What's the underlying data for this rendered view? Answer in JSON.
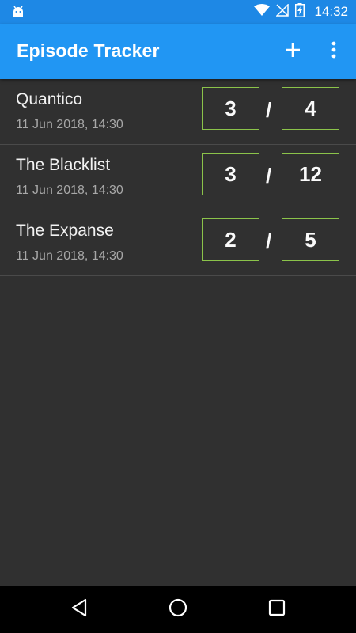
{
  "status_bar": {
    "time": "14:32",
    "icons": [
      "android-icon",
      "wifi-icon",
      "no-signal-icon",
      "battery-charging-icon"
    ]
  },
  "app_bar": {
    "title": "Episode Tracker",
    "actions": [
      "add-icon",
      "overflow-menu-icon"
    ]
  },
  "shows": [
    {
      "title": "Quantico",
      "date": "11 Jun 2018, 14:30",
      "watched": "3",
      "separator": "/",
      "total": "4"
    },
    {
      "title": "The Blacklist",
      "date": "11 Jun 2018, 14:30",
      "watched": "3",
      "separator": "/",
      "total": "12"
    },
    {
      "title": "The Expanse",
      "date": "11 Jun 2018, 14:30",
      "watched": "2",
      "separator": "/",
      "total": "5"
    }
  ],
  "nav_bar": {
    "buttons": [
      "back-icon",
      "home-icon",
      "recents-icon"
    ]
  },
  "colors": {
    "status_bar": "#1e88e5",
    "app_bar": "#2196f3",
    "background": "#303030",
    "box_border": "#8bc34a",
    "nav_bar": "#000000"
  }
}
